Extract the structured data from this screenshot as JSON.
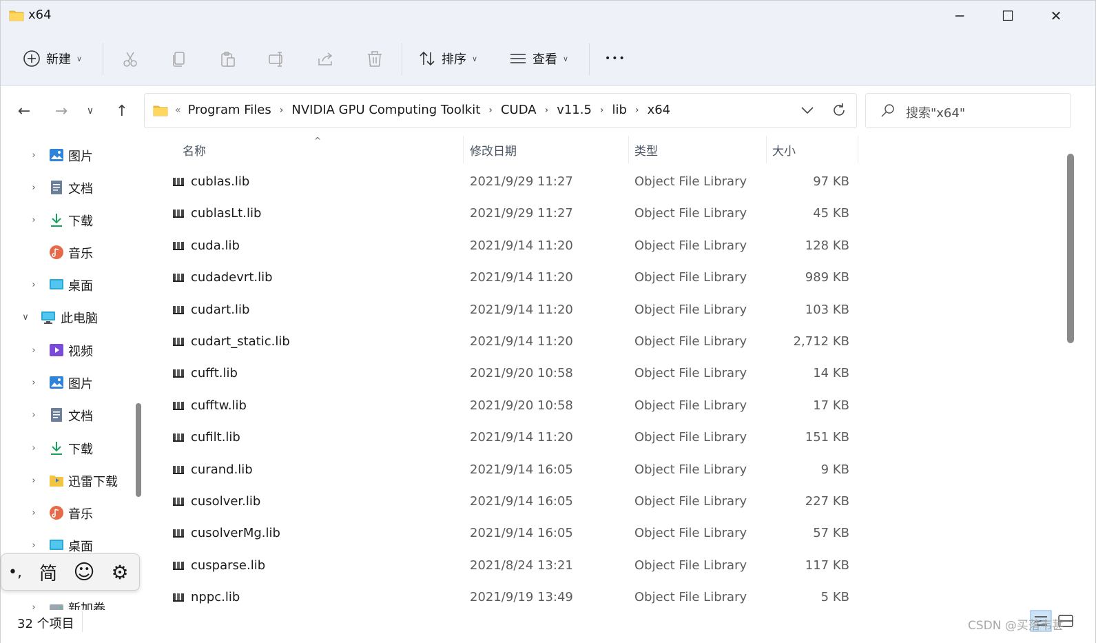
{
  "window": {
    "title": "x64",
    "controls": {
      "minimize": "─",
      "maximize": "☐",
      "close": "✕"
    }
  },
  "commandbar": {
    "new_label": "新建",
    "sort_label": "排序",
    "view_label": "查看",
    "more_label": "•••",
    "icons": [
      "cut-icon",
      "copy-icon",
      "paste-icon",
      "rename-icon",
      "share-icon",
      "delete-icon"
    ]
  },
  "nav": {
    "back": "←",
    "forward": "→",
    "recent": "∨",
    "up": "↑"
  },
  "address": {
    "lead": "«",
    "crumbs": [
      "Program Files",
      "NVIDIA GPU Computing Toolkit",
      "CUDA",
      "v11.5",
      "lib",
      "x64"
    ],
    "sep": "›"
  },
  "search": {
    "placeholder": "搜索\"x64\""
  },
  "navpane": {
    "items": [
      {
        "label": "图片",
        "icon": "pictures-icon",
        "expander": "›"
      },
      {
        "label": "文档",
        "icon": "documents-icon",
        "expander": "›"
      },
      {
        "label": "下载",
        "icon": "downloads-icon",
        "expander": "›"
      },
      {
        "label": "音乐",
        "icon": "music-icon",
        "expander": ""
      },
      {
        "label": "桌面",
        "icon": "desktop-icon",
        "expander": "›"
      },
      {
        "label": "此电脑",
        "icon": "this-pc-icon",
        "expander": "∨"
      },
      {
        "label": "视频",
        "icon": "videos-icon",
        "expander": "›"
      },
      {
        "label": "图片",
        "icon": "pictures-icon",
        "expander": "›"
      },
      {
        "label": "文档",
        "icon": "documents-icon",
        "expander": "›"
      },
      {
        "label": "下载",
        "icon": "downloads-icon",
        "expander": "›"
      },
      {
        "label": "迅雷下载",
        "icon": "xunlei-folder-icon",
        "expander": "›"
      },
      {
        "label": "音乐",
        "icon": "music-icon",
        "expander": "›"
      },
      {
        "label": "桌面",
        "icon": "desktop-icon",
        "expander": "›"
      },
      {
        "label": "新加卷 (D:)",
        "icon": "drive-icon",
        "expander": "›"
      }
    ]
  },
  "columns": {
    "name": "名称",
    "date": "修改日期",
    "type": "类型",
    "size": "大小",
    "sort_caret": "^"
  },
  "files": [
    {
      "name": "cublas.lib",
      "date": "2021/9/29 11:27",
      "type": "Object File Library",
      "size": "97 KB"
    },
    {
      "name": "cublasLt.lib",
      "date": "2021/9/29 11:27",
      "type": "Object File Library",
      "size": "45 KB"
    },
    {
      "name": "cuda.lib",
      "date": "2021/9/14 11:20",
      "type": "Object File Library",
      "size": "128 KB"
    },
    {
      "name": "cudadevrt.lib",
      "date": "2021/9/14 11:20",
      "type": "Object File Library",
      "size": "989 KB"
    },
    {
      "name": "cudart.lib",
      "date": "2021/9/14 11:20",
      "type": "Object File Library",
      "size": "103 KB"
    },
    {
      "name": "cudart_static.lib",
      "date": "2021/9/14 11:20",
      "type": "Object File Library",
      "size": "2,712 KB"
    },
    {
      "name": "cufft.lib",
      "date": "2021/9/20 10:58",
      "type": "Object File Library",
      "size": "14 KB"
    },
    {
      "name": "cufftw.lib",
      "date": "2021/9/20 10:58",
      "type": "Object File Library",
      "size": "17 KB"
    },
    {
      "name": "cufilt.lib",
      "date": "2021/9/14 11:20",
      "type": "Object File Library",
      "size": "151 KB"
    },
    {
      "name": "curand.lib",
      "date": "2021/9/14 16:05",
      "type": "Object File Library",
      "size": "9 KB"
    },
    {
      "name": "cusolver.lib",
      "date": "2021/9/14 16:05",
      "type": "Object File Library",
      "size": "227 KB"
    },
    {
      "name": "cusolverMg.lib",
      "date": "2021/9/14 16:05",
      "type": "Object File Library",
      "size": "57 KB"
    },
    {
      "name": "cusparse.lib",
      "date": "2021/8/24 13:21",
      "type": "Object File Library",
      "size": "117 KB"
    },
    {
      "name": "nppc.lib",
      "date": "2021/9/19 13:49",
      "type": "Object File Library",
      "size": "5 KB"
    }
  ],
  "status": {
    "count": "32 个项目",
    "watermark": "CSDN @买落韦葚"
  },
  "ime": {
    "punct": "•,",
    "mode": "简",
    "emoji": "☺",
    "settings": "⚙"
  },
  "colors": {
    "chrome_bg": "#eef2f8",
    "folder_yellow": "#f5c342",
    "accent_blue": "#0067c0"
  }
}
